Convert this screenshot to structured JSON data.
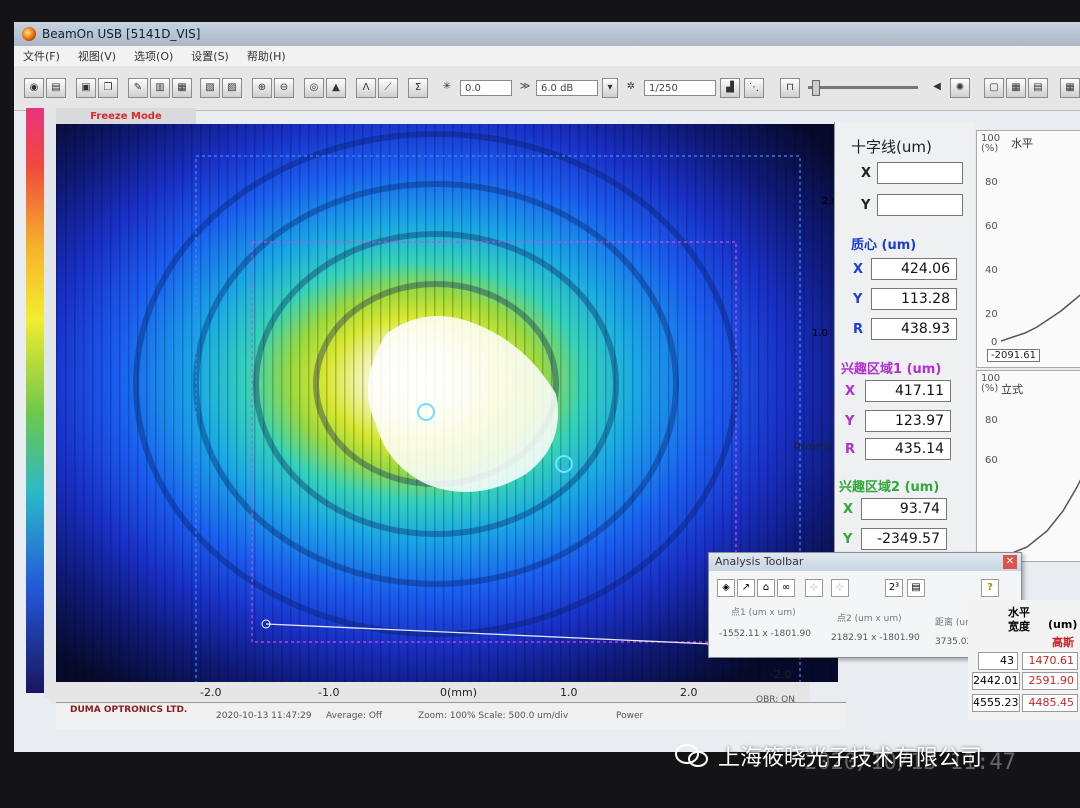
{
  "window": {
    "title": "BeamOn USB  [5141D_VIS]"
  },
  "menu": [
    "文件(F)",
    "视图(V)",
    "选项(O)",
    "设置(S)",
    "帮助(H)"
  ],
  "toolbar": {
    "exposure_value": "0.0",
    "gain_value": "6.0 dB",
    "shutter_value": "1/250"
  },
  "image": {
    "mode_label": "Freeze Mode",
    "scale_y": [
      "2.0",
      "1.0",
      "0(mm)"
    ],
    "scale_x": [
      "-2.0",
      "-1.0",
      "0(mm)",
      "1.0",
      "2.0"
    ],
    "right_edge_labels": [
      "2.0",
      "1.0",
      "-2.0"
    ]
  },
  "status": {
    "company": "DUMA OPTRONICS LTD.",
    "timestamp": "2020-10-13 11:47:29",
    "average": "Average: Off",
    "zoom_scale": "Zoom: 100%  Scale: 500.0 um/div",
    "power": "Power",
    "obr": "OBR: ON"
  },
  "crosshair": {
    "title": "十字线(um)",
    "x_label": "X",
    "y_label": "Y",
    "x_value": "",
    "y_value": ""
  },
  "centroid": {
    "title": "质心 (um)",
    "x_label": "X",
    "x_value": "424.06",
    "y_label": "Y",
    "y_value": "113.28",
    "r_label": "R",
    "r_value": "438.93"
  },
  "roi1": {
    "title": "兴趣区域1 (um)",
    "x_label": "X",
    "x_value": "417.11",
    "y_label": "Y",
    "y_value": "123.97",
    "r_label": "R",
    "r_value": "435.14"
  },
  "roi2": {
    "title": "兴趣区域2 (um)",
    "x_label": "X",
    "x_value": "93.74",
    "y_label": "Y",
    "y_value": "-2349.57"
  },
  "graph_horizontal": {
    "title": "水平",
    "y_ticks": [
      "100",
      "80",
      "60",
      "40",
      "20",
      "0"
    ],
    "unit": "(%)",
    "readout": "-2091.61"
  },
  "graph_vertical": {
    "title": "立式",
    "y_ticks": [
      "100",
      "80",
      "60"
    ],
    "unit": "(%)"
  },
  "analysis_toolbar": {
    "title": "Analysis Toolbar",
    "point1_label": "点1 (um x um)",
    "point2_label": "点2 (um x um)",
    "distance_label": "距离 (um)",
    "point1_value": "-1552.11 x -1801.90",
    "point2_value": "2182.91 x -1801.90",
    "distance_value": "3735.02"
  },
  "width_table": {
    "header1": "水平",
    "header2": "宽度",
    "header_unit": "(um)",
    "header_gauss": "高斯",
    "rows": [
      {
        "a": "43",
        "b": "1470.61"
      },
      {
        "a": "2442.01",
        "b": "2591.90"
      },
      {
        "a": "4555.23",
        "b": "4485.45"
      }
    ]
  },
  "overlay": {
    "watermark": "上海筱晓光子技术有限公司",
    "photo_date": "2020/10/13 11:47"
  },
  "colors": {
    "accent_blue": "#1a3fd0",
    "roi_purple": "#b02fd0",
    "roi2_green": "#2ea83a",
    "value_red": "#cc2222"
  }
}
